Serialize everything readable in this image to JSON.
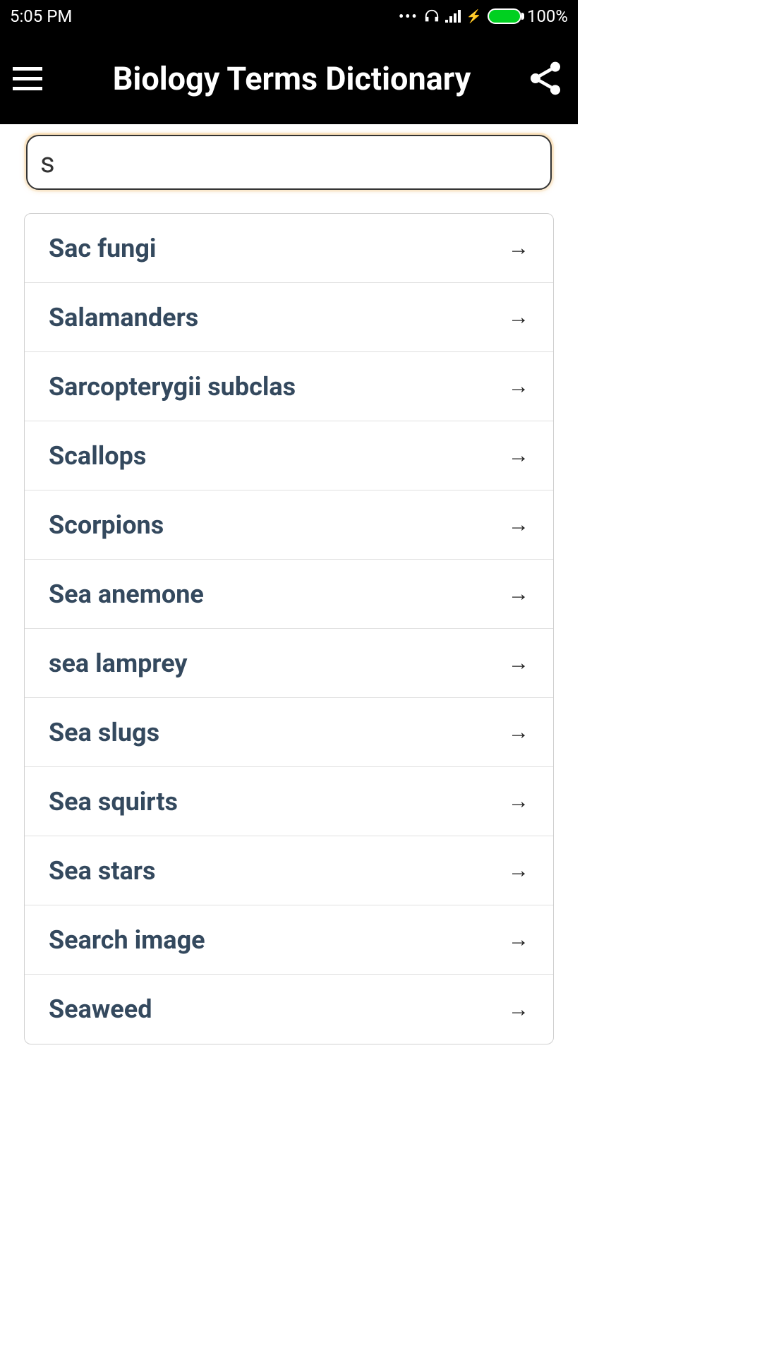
{
  "status_bar": {
    "time": "5:05 PM",
    "battery_percent": "100%"
  },
  "header": {
    "title": "Biology Terms Dictionary"
  },
  "search": {
    "value": "s"
  },
  "list": {
    "items": [
      {
        "label": "Sac fungi"
      },
      {
        "label": "Salamanders"
      },
      {
        "label": "Sarcopterygii subclas"
      },
      {
        "label": "Scallops"
      },
      {
        "label": "Scorpions"
      },
      {
        "label": "Sea anemone"
      },
      {
        "label": "sea lamprey"
      },
      {
        "label": "Sea slugs"
      },
      {
        "label": "Sea squirts"
      },
      {
        "label": "Sea stars"
      },
      {
        "label": "Search image"
      },
      {
        "label": "Seaweed"
      }
    ]
  },
  "icons": {
    "arrow": "→"
  }
}
